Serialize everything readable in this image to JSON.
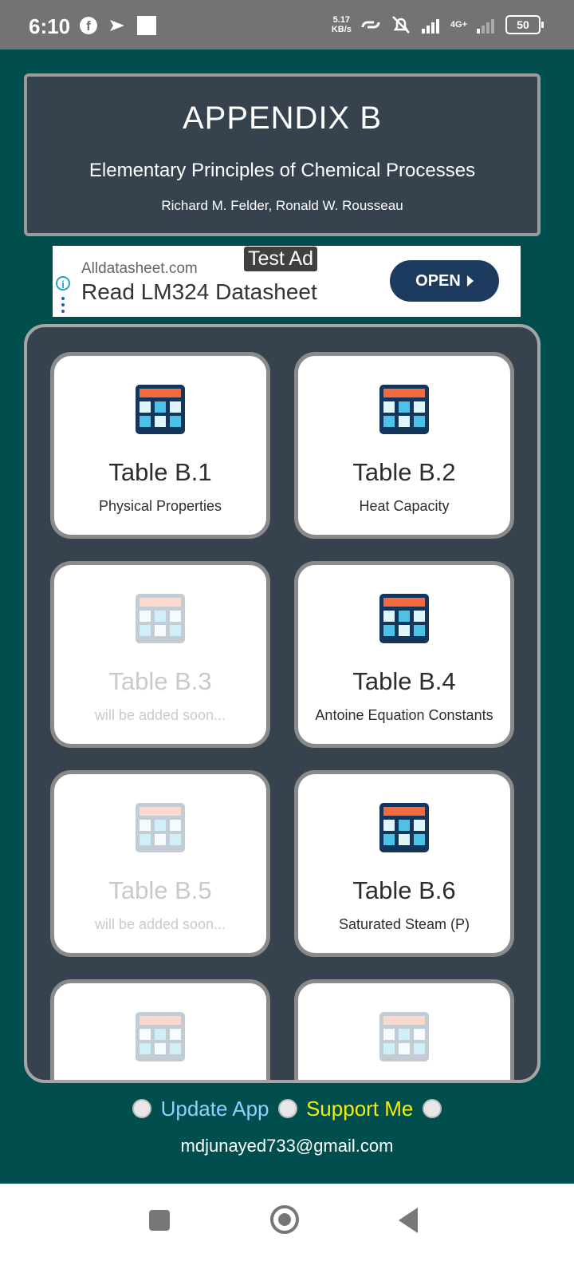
{
  "status_bar": {
    "time": "6:10",
    "net_speed_value": "5.17",
    "net_speed_unit": "KB/s",
    "network": "4G+",
    "battery": "50"
  },
  "header": {
    "title": "APPENDIX B",
    "subtitle": "Elementary Principles of Chemical Processes",
    "authors": "Richard M. Felder, Ronald W. Rousseau"
  },
  "ad": {
    "badge": "Test Ad",
    "source": "Alldatasheet.com",
    "headline": "Read LM324 Datasheet",
    "button_label": "OPEN"
  },
  "tables": [
    {
      "title": "Table B.1",
      "desc": "Physical Properties",
      "enabled": true
    },
    {
      "title": "Table B.2",
      "desc": "Heat Capacity",
      "enabled": true
    },
    {
      "title": "Table B.3",
      "desc": "will be added soon...",
      "enabled": false
    },
    {
      "title": "Table B.4",
      "desc": "Antoine Equation Constants",
      "enabled": true
    },
    {
      "title": "Table B.5",
      "desc": "will be added soon...",
      "enabled": false
    },
    {
      "title": "Table B.6",
      "desc": "Saturated Steam (P)",
      "enabled": true
    },
    {
      "title": "",
      "desc": "",
      "enabled": false
    },
    {
      "title": "",
      "desc": "",
      "enabled": false
    }
  ],
  "footer": {
    "update_label": "Update App",
    "support_label": "Support Me",
    "email": "mdjunayed733@gmail.com"
  },
  "colors": {
    "background": "#004e4d",
    "card_panel": "#36434f",
    "icon_header": "#f26a3d",
    "icon_cells": "#4cc3e6",
    "icon_frame": "#13365a"
  }
}
